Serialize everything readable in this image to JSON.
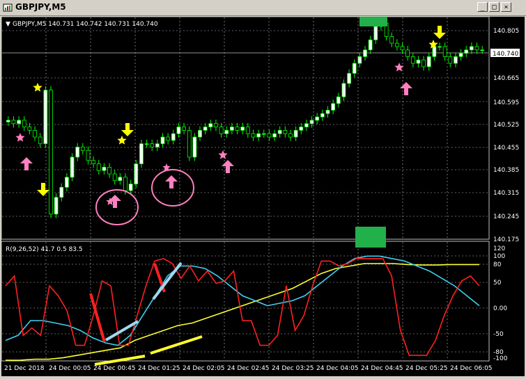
{
  "window": {
    "title": "GBPJPY,M5",
    "buttons": [
      "_",
      "□",
      "×"
    ]
  },
  "main_chart": {
    "header": "GBPJPY,M5  140.731 140.742 140.731 140.740",
    "price_labels": [
      "140.805",
      "140.740",
      "140.665",
      "140.595",
      "140.525",
      "140.455",
      "140.385",
      "140.315",
      "140.245",
      "140.175"
    ],
    "current_price": "140.740",
    "colors": {
      "bull": "#ffffff",
      "bear": "#000000",
      "wick": "#00ff00",
      "grid": "#c0c0c0",
      "axis_text": "#ffffff",
      "price_line": "#c0c0c0"
    }
  },
  "indicator": {
    "header": "R(9,26,52) 41.7 0.5 83.5",
    "levels": [
      "120",
      "100",
      "80",
      "50",
      "0.00",
      "-50",
      "-80",
      "-100"
    ],
    "colors": {
      "red": "#ff2020",
      "cyan": "#40d0f0",
      "yellow": "#ffff30"
    }
  },
  "time_axis": [
    "21 Dec 2018",
    "24 Dec 00:05",
    "24 Dec 00:45",
    "24 Dec 01:25",
    "24 Dec 02:05",
    "24 Dec 02:45",
    "24 Dec 03:25",
    "24 Dec 04:05",
    "24 Dec 04:45",
    "24 Dec 05:25",
    "24 Dec 06:05"
  ],
  "annotations": {
    "marker_colors": {
      "star": "#ffff00",
      "pink": "#ff80c0",
      "down_arrow": "#ffff00",
      "box": "#22b04a"
    },
    "icons": [
      "star-icon",
      "pink-star-icon",
      "up-arrow-icon",
      "down-arrow-icon",
      "circle-annotation",
      "green-box"
    ]
  },
  "chart_data": {
    "type": "candlestick",
    "title": "GBPJPY,M5",
    "ylim": [
      140.175,
      140.835
    ],
    "close_series_approx": [
      140.53,
      140.52,
      140.53,
      140.51,
      140.5,
      140.48,
      140.46,
      140.62,
      140.25,
      140.3,
      140.33,
      140.36,
      140.42,
      140.45,
      140.44,
      140.41,
      140.4,
      140.38,
      140.39,
      140.37,
      140.35,
      140.36,
      140.32,
      140.34,
      140.4,
      140.46,
      140.46,
      140.45,
      140.46,
      140.48,
      140.47,
      140.49,
      140.51,
      140.5,
      140.42,
      140.48,
      140.5,
      140.51,
      140.52,
      140.51,
      140.49,
      140.5,
      140.51,
      140.5,
      140.51,
      140.49,
      140.48,
      140.49,
      140.49,
      140.48,
      140.49,
      140.5,
      140.49,
      140.48,
      140.5,
      140.51,
      140.52,
      140.53,
      140.54,
      140.55,
      140.56,
      140.58,
      140.6,
      140.64,
      140.67,
      140.7,
      140.72,
      140.74,
      140.77,
      140.81,
      140.82,
      140.78,
      140.76,
      140.75,
      140.74,
      140.72,
      140.7,
      140.71,
      140.69,
      140.72,
      140.75,
      140.75,
      140.72,
      140.7,
      140.72,
      140.73,
      140.74,
      140.75,
      140.74,
      140.74
    ],
    "indicator_series": {
      "names": [
        "red",
        "cyan",
        "yellow"
      ],
      "last": [
        41.7,
        0.5,
        83.5
      ]
    }
  }
}
